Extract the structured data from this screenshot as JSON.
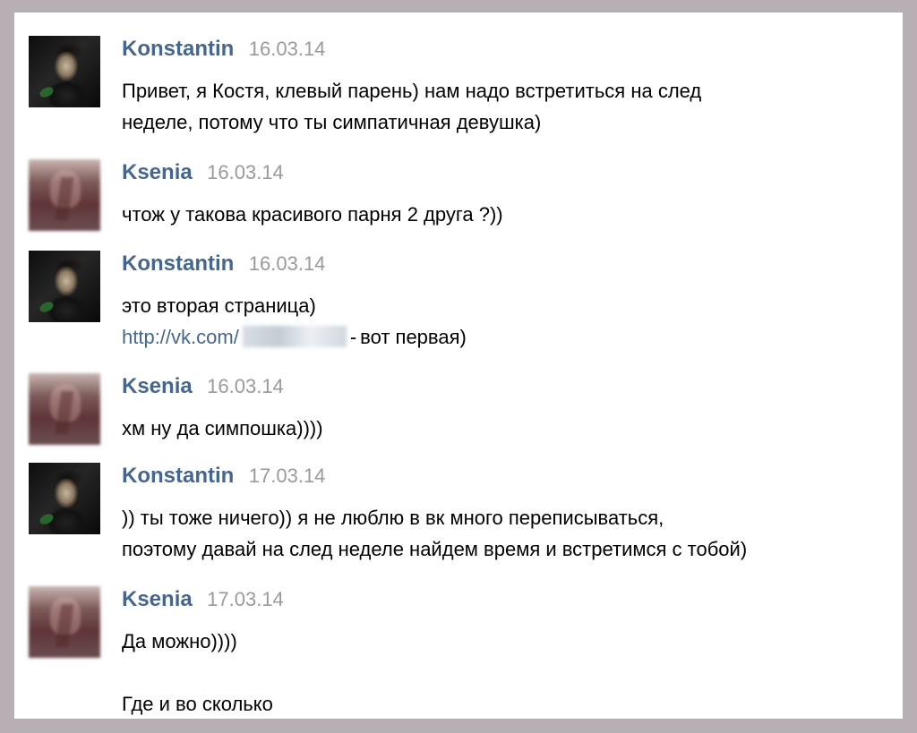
{
  "messages": [
    {
      "author": "Konstantin",
      "date": "16.03.14",
      "avatar": "konstantin-avatar",
      "lines": [
        "Привет, я Костя, клевый парень) нам надо встретиться на след",
        "неделе, потому что ты симпатичная девушка)"
      ]
    },
    {
      "author": "Ksenia",
      "date": "16.03.14",
      "avatar": "ksenia-avatar",
      "lines": [
        "чтож у такова красивого парня 2 друга ?))"
      ]
    },
    {
      "author": "Konstantin",
      "date": "16.03.14",
      "avatar": "konstantin-avatar",
      "lines": [
        "это вторая страница)"
      ],
      "link_line": {
        "prefix": "http://vk.com/",
        "dash": "-",
        "suffix": "вот первая)"
      }
    },
    {
      "author": "Ksenia",
      "date": "16.03.14",
      "avatar": "ksenia-avatar",
      "lines": [
        "хм ну да симпошка))))"
      ]
    },
    {
      "author": "Konstantin",
      "date": "17.03.14",
      "avatar": "konstantin-avatar",
      "lines": [
        ")) ты тоже ничего)) я не люблю в вк много переписываться,",
        "поэтому давай на след неделе найдем время и встретимся с тобой)"
      ]
    },
    {
      "author": "Ksenia",
      "date": "17.03.14",
      "avatar": "ksenia-avatar",
      "lines": [
        "Да можно))))",
        "",
        "Где и во сколько"
      ]
    }
  ],
  "colors": {
    "outer_background": "#b7aeb3",
    "panel_background": "#ffffff",
    "name": "#45668e",
    "date": "#9a9a9a",
    "text": "#000000",
    "link": "#45668e"
  }
}
